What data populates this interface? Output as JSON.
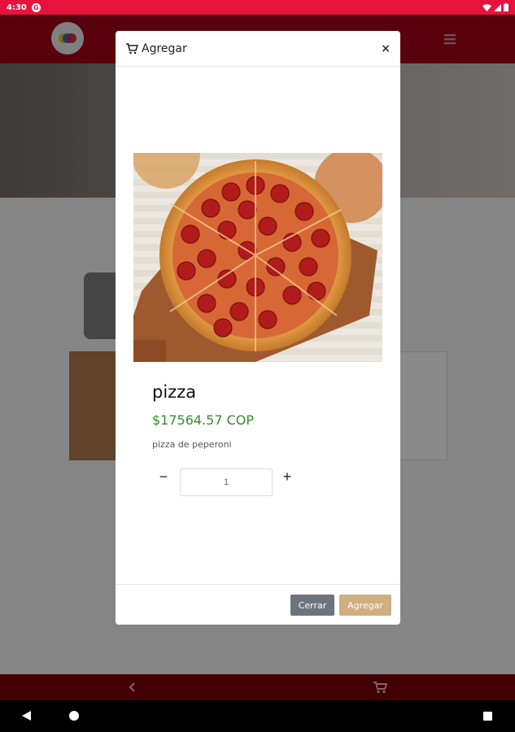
{
  "status_bar": {
    "time": "4:30",
    "badge": "G"
  },
  "modal": {
    "title": "Agregar",
    "close_symbol": "×",
    "product": {
      "name": "pizza",
      "price": "$17564.57 COP",
      "description": "pizza de peperoni"
    },
    "quantity": {
      "value": "1",
      "minus": "−",
      "plus": "+"
    },
    "buttons": {
      "close": "Cerrar",
      "add": "Agregar"
    }
  },
  "icons": {
    "title_icon": "cart-icon",
    "menu": "hamburger-menu-icon",
    "bottom_back": "chevron-left-icon",
    "bottom_cart": "cart-icon"
  },
  "colors": {
    "status_bar": "#e8123f",
    "header": "#a30018",
    "bottom_bar": "#7a0008",
    "price": "#3a8a2e",
    "close_button": "#6c757d",
    "add_button": "#cfae7f"
  }
}
